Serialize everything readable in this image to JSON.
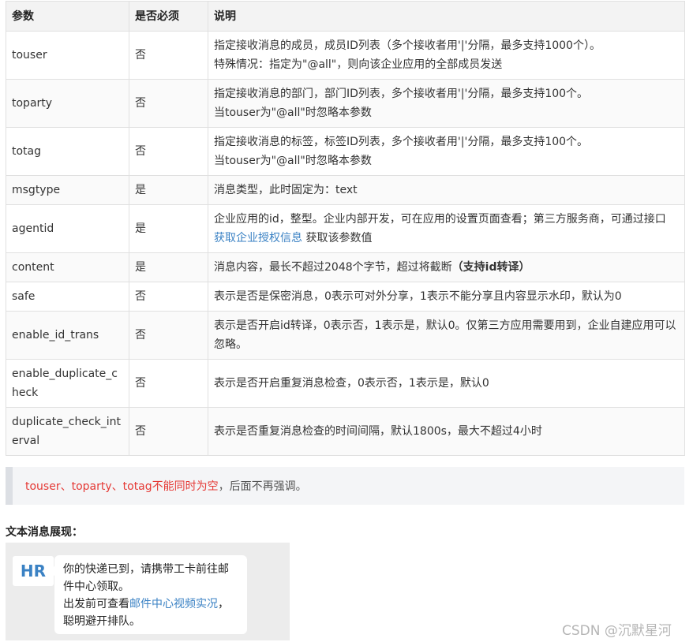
{
  "table": {
    "headers": [
      "参数",
      "是否必须",
      "说明"
    ],
    "rows": [
      {
        "name": "touser",
        "required": "否",
        "desc_line1": "指定接收消息的成员，成员ID列表（多个接收者用'|'分隔，最多支持1000个）。",
        "desc_line2": "特殊情况：指定为\"@all\"，则向该企业应用的全部成员发送"
      },
      {
        "name": "toparty",
        "required": "否",
        "desc_line1": "指定接收消息的部门，部门ID列表，多个接收者用'|'分隔，最多支持100个。",
        "desc_line2": "当touser为\"@all\"时忽略本参数"
      },
      {
        "name": "totag",
        "required": "否",
        "desc_line1": "指定接收消息的标签，标签ID列表，多个接收者用'|'分隔，最多支持100个。",
        "desc_line2": "当touser为\"@all\"时忽略本参数"
      },
      {
        "name": "msgtype",
        "required": "是",
        "desc": "消息类型，此时固定为：text"
      },
      {
        "name": "agentid",
        "required": "是",
        "desc_pre": "企业应用的id，整型。企业内部开发，可在应用的设置页面查看；第三方服务商，可通过接口 ",
        "desc_link": "获取企业授权信息",
        "desc_post": " 获取该参数值"
      },
      {
        "name": "content",
        "required": "是",
        "desc_pre": "消息内容，最长不超过2048个字节，超过将截断",
        "desc_bold": "（支持id转译）"
      },
      {
        "name": "safe",
        "required": "否",
        "desc": "表示是否是保密消息，0表示可对外分享，1表示不能分享且内容显示水印，默认为0"
      },
      {
        "name": "enable_id_trans",
        "required": "否",
        "desc": "表示是否开启id转译，0表示否，1表示是，默认0。仅第三方应用需要用到，企业自建应用可以忽略。"
      },
      {
        "name": "enable_duplicate_check",
        "required": "否",
        "desc": "表示是否开启重复消息检查，0表示否，1表示是，默认0"
      },
      {
        "name": "duplicate_check_interval",
        "required": "否",
        "desc": "表示是否重复消息检查的时间间隔，默认1800s，最大不超过4小时"
      }
    ]
  },
  "note": {
    "warning": "touser、toparty、totag不能同时为空",
    "rest": "，后面不再强调。"
  },
  "section_title": "文本消息展现：",
  "demo": {
    "avatar": "HR",
    "line1": "你的快递已到，请携带工卡前往邮件中心领取。",
    "line2_pre": "出发前可查看",
    "line2_link": "邮件中心视频实况",
    "line2_post": "，聪明避开排队。"
  },
  "watermark": "CSDN @沉默星河",
  "colors": {
    "link": "#3b82c4",
    "warning": "#e53935",
    "header_bg": "#f3f3f3"
  }
}
